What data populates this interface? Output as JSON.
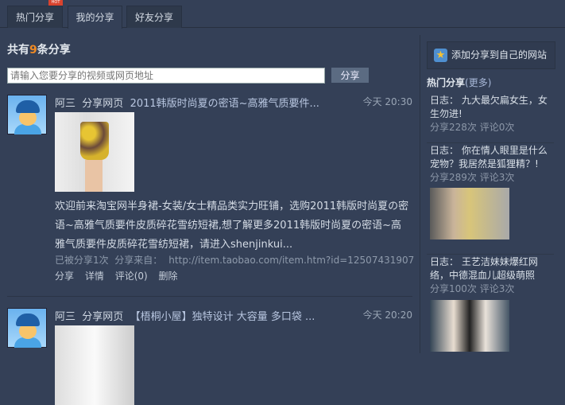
{
  "tabs": [
    {
      "label": "热门分享",
      "badge": "HOT"
    },
    {
      "label": "我的分享"
    },
    {
      "label": "好友分享"
    }
  ],
  "active_tab": "我的分享",
  "count": {
    "prefix": "共有",
    "number": "9",
    "suffix": "条分享"
  },
  "share_input": {
    "value": "",
    "placeholder": "请输入您要分享的视频或网页地址"
  },
  "share_button": "分享",
  "items": [
    {
      "user": "阿三",
      "action": "分享网页",
      "title": "2011韩版时尚夏の密语~高雅气质要件...",
      "time": "今天  20:30",
      "desc": "欢迎前来淘宝网半身裙-女装/女士精品类实力旺铺，选购2011韩版时尚夏の密语~高雅气质要件皮质碎花雪纺短裙,想了解更多2011韩版时尚夏の密语~高雅气质要件皮质碎花雪纺短裙，请进入shenjinkui...",
      "shared": "已被分享1次",
      "from_label": "分享来自：",
      "url": "http://item.taobao.com/item.htm?id=12507431907",
      "actions": [
        "分享",
        "详情",
        "评论(0)",
        "删除"
      ]
    },
    {
      "user": "阿三",
      "action": "分享网页",
      "title": "【梧桐小屋】独特设计 大容量 多口袋 ...",
      "time": "今天  20:20"
    }
  ],
  "sidebar": {
    "add_label": "添加分享到自己的网站",
    "hot_title": "热门分享",
    "more": "(更多)",
    "hot": [
      {
        "title": "日志：  九大最欠扁女生，女生勿进!",
        "stats": "分享228次  评论0次"
      },
      {
        "title": "日志：  你在情人眼里是什么宠物？我居然是狐狸精？!",
        "stats": "分享289次  评论3次"
      },
      {
        "title": "日志：  王艺洁妹妹爆红网络，中德混血儿超级萌照",
        "stats": "分享100次  评论3次"
      }
    ]
  },
  "colors": {
    "background": "#344057",
    "accent": "#f08a24"
  }
}
